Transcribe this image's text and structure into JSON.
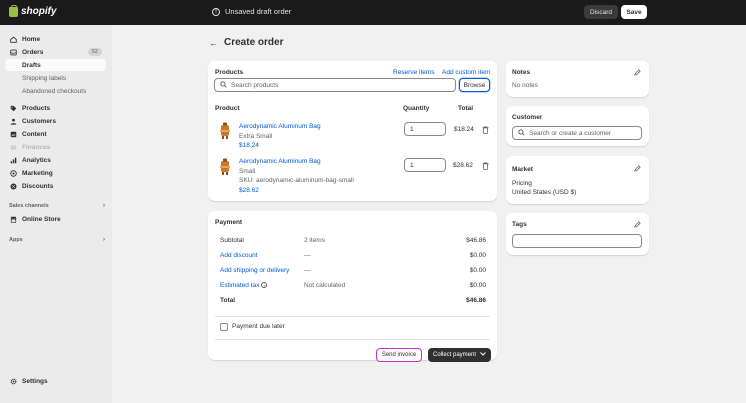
{
  "topbar": {
    "logo_text": "shopify",
    "draft_status": "Unsaved draft order",
    "discard_label": "Discard",
    "save_label": "Save"
  },
  "sidebar": {
    "items": [
      {
        "label": "Home",
        "icon": "home-icon"
      },
      {
        "label": "Orders",
        "icon": "orders-icon",
        "badge": "52"
      },
      {
        "label": "Drafts"
      },
      {
        "label": "Shipping labels"
      },
      {
        "label": "Abandoned checkouts"
      },
      {
        "label": "Products",
        "icon": "tag-icon"
      },
      {
        "label": "Customers",
        "icon": "person-icon"
      },
      {
        "label": "Content",
        "icon": "content-icon"
      },
      {
        "label": "Finances",
        "icon": "finances-icon"
      },
      {
        "label": "Analytics",
        "icon": "analytics-icon"
      },
      {
        "label": "Marketing",
        "icon": "marketing-icon"
      },
      {
        "label": "Discounts",
        "icon": "discount-icon"
      }
    ],
    "sales_channels_label": "Sales channels",
    "online_store_label": "Online Store",
    "apps_label": "Apps",
    "settings_label": "Settings"
  },
  "page": {
    "title": "Create order"
  },
  "products_card": {
    "title": "Products",
    "reserve_label": "Reserve items",
    "add_custom_label": "Add custom item",
    "search_placeholder": "Search products",
    "browse_label": "Browse",
    "col_product": "Product",
    "col_quantity": "Quantity",
    "col_total": "Total",
    "rows": [
      {
        "name": "Aerodynamic Aluminum Bag",
        "variant": "Extra Small",
        "sku": "",
        "price": "$18.24",
        "quantity": "1",
        "total": "$18.24"
      },
      {
        "name": "Aerodynamic Aluminum Bag",
        "variant": "Small",
        "sku": "SKU: aerodynamic-aluminum-bag-small",
        "price": "$28.62",
        "quantity": "1",
        "total": "$28.62"
      }
    ]
  },
  "payment_card": {
    "title": "Payment",
    "subtotal_label": "Subtotal",
    "subtotal_items": "2 items",
    "subtotal_value": "$46.86",
    "discount_label": "Add discount",
    "discount_mid": "—",
    "discount_value": "$0.00",
    "shipping_label": "Add shipping or delivery",
    "shipping_mid": "—",
    "shipping_value": "$0.00",
    "tax_label": "Estimated tax",
    "tax_mid": "Not calculated",
    "tax_value": "$0.00",
    "total_label": "Total",
    "total_value": "$46.86",
    "payment_due_label": "Payment due later",
    "send_invoice_label": "Send invoice",
    "collect_payment_label": "Collect payment"
  },
  "notes_card": {
    "title": "Notes",
    "text": "No notes"
  },
  "customer_card": {
    "title": "Customer",
    "search_placeholder": "Search or create a customer"
  },
  "market_card": {
    "title": "Market",
    "pricing_label": "Pricing",
    "pricing_value": "United States (USD $)"
  },
  "tags_card": {
    "title": "Tags"
  },
  "colors": {
    "topbar_bg": "#1a1a1a",
    "link": "#005bd3",
    "invoice_outline": "#c42fc4",
    "primary_button": "#303030"
  }
}
